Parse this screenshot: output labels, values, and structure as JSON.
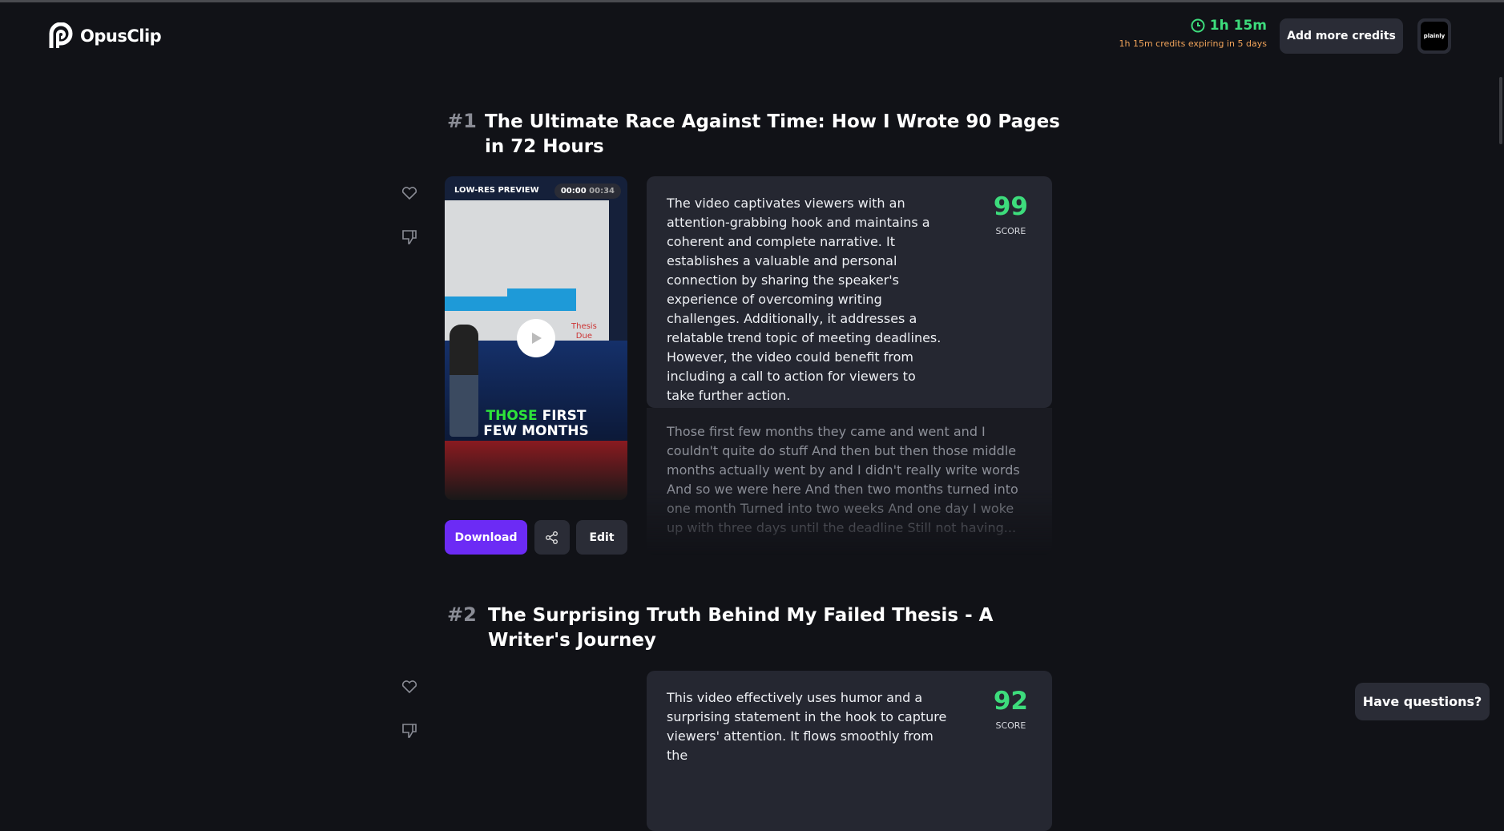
{
  "header": {
    "brand": "OpusClip",
    "credits": "1h 15m",
    "credits_note": "1h 15m credits expiring in 5 days",
    "add_credits": "Add more credits",
    "avatar": "plainly",
    "accent_green": "#3ddc7c",
    "accent_orange": "#f0a35a"
  },
  "clips": [
    {
      "rank": "#1",
      "title": "The Ultimate Race Against Time: How I Wrote 90 Pages in 72 Hours",
      "preview_label": "LOW-RES PREVIEW",
      "time_current": "00:00",
      "time_total": "00:34",
      "caption_green": "THOSE",
      "caption_white1": "FIRST",
      "caption_white2": "FEW MONTHS",
      "slide_text1": "Thesis",
      "slide_text2": "Due",
      "description": "The video captivates viewers with an attention-grabbing hook and maintains a coherent and complete narrative. It establishes a valuable and personal connection by sharing the speaker's experience of overcoming writing challenges. Additionally, it addresses a relatable trend topic of meeting deadlines. However, the video could benefit from including a call to action for viewers to take further action.",
      "score": "99",
      "score_label": "SCORE",
      "transcript": "Those first few months they came and went and I couldn't quite do stuff And then but then those middle months actually went by and I didn't really write words And so we were here And then two months turned into one month Turned into two weeks And one day I woke up with three days until the deadline Still not having...",
      "download": "Download",
      "edit": "Edit"
    },
    {
      "rank": "#2",
      "title": "The Surprising Truth Behind My Failed Thesis - A Writer's Journey",
      "description": "This video effectively uses humor and a surprising statement in the hook to capture viewers' attention. It flows smoothly from the",
      "score": "92",
      "score_label": "SCORE"
    }
  ],
  "help": "Have questions?",
  "download_color": "#6c2bf5"
}
